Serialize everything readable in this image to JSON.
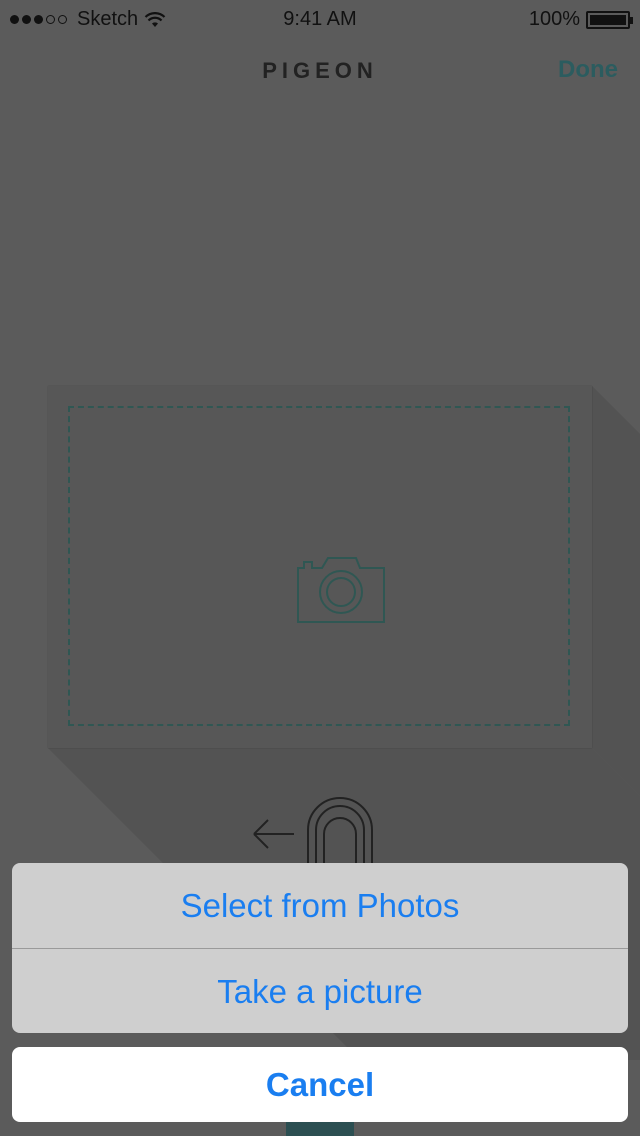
{
  "status_bar": {
    "carrier": "Sketch",
    "time": "9:41 AM",
    "battery": "100%",
    "signal_bars_filled": 3,
    "signal_bars_total": 5
  },
  "nav": {
    "title": "PIGEON",
    "done_label": "Done"
  },
  "photo_area": {
    "icon": "camera-icon"
  },
  "gesture_hint": {
    "icon": "swipe-left-gesture-icon"
  },
  "action_sheet": {
    "options": [
      {
        "label": "Select from Photos"
      },
      {
        "label": "Take a picture"
      }
    ],
    "cancel_label": "Cancel"
  },
  "colors": {
    "accent": "#1a7ef0",
    "dim_overlay": "#5b5b5b",
    "teal": "#2c4f52"
  }
}
